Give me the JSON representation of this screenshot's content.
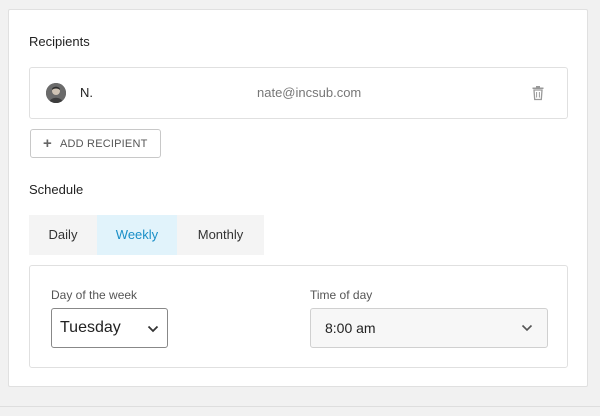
{
  "recipients": {
    "title": "Recipients",
    "items": [
      {
        "name": "N.",
        "email": "nate@incsub.com"
      }
    ],
    "add_label": "ADD RECIPIENT"
  },
  "schedule": {
    "title": "Schedule",
    "tabs": [
      {
        "label": "Daily",
        "active": false
      },
      {
        "label": "Weekly",
        "active": true
      },
      {
        "label": "Monthly",
        "active": false
      }
    ],
    "day_label": "Day of the week",
    "day_value": "Tuesday",
    "time_label": "Time of day",
    "time_value": "8:00 am"
  },
  "colors": {
    "accent": "#1a8fc7",
    "active_tab_bg": "#e1f3fb"
  },
  "icons": {
    "trash": "trash-icon",
    "plus": "plus-icon",
    "chevron": "chevron-down-icon"
  }
}
